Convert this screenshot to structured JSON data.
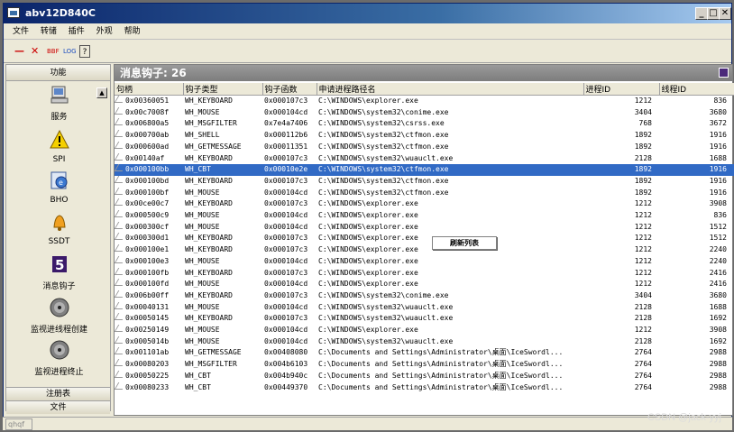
{
  "window": {
    "title": "abv12D840C"
  },
  "menu": [
    "文件",
    "转储",
    "插件",
    "外观",
    "帮助"
  ],
  "toolbar": {
    "minus": "—",
    "close": "✕",
    "bbf": "BBF",
    "log": "LOG",
    "help": "?"
  },
  "sidebar": {
    "header": "功能",
    "items": [
      {
        "label": "服务",
        "icon": "computer-icon"
      },
      {
        "label": "SPI",
        "icon": "warning-icon"
      },
      {
        "label": "BHO",
        "icon": "browser-icon"
      },
      {
        "label": "SSDT",
        "icon": "bell-icon"
      },
      {
        "label": "消息钩子",
        "icon": "hook-icon"
      },
      {
        "label": "监视进线程创建",
        "icon": "monitor-icon"
      },
      {
        "label": "监视进程终止",
        "icon": "monitor-icon"
      }
    ],
    "footer": [
      "注册表",
      "文件"
    ]
  },
  "content": {
    "banner": "消息钩子: 26",
    "columns": [
      "句柄",
      "钩子类型",
      "钩子函数",
      "申请进程路径名",
      "进程ID",
      "线程ID"
    ],
    "rows": [
      [
        "0x00360051",
        "WH_KEYBOARD",
        "0x000107c3",
        "C:\\WINDOWS\\explorer.exe",
        "1212",
        "836"
      ],
      [
        "0x00c7008f",
        "WH_MOUSE",
        "0x000104cd",
        "C:\\WINDOWS\\system32\\conime.exe",
        "3404",
        "3680"
      ],
      [
        "0x006800a5",
        "WH_MSGFILTER",
        "0x7e4a7406",
        "C:\\WINDOWS\\system32\\csrss.exe",
        "768",
        "3672"
      ],
      [
        "0x000700ab",
        "WH_SHELL",
        "0x000112b6",
        "C:\\WINDOWS\\system32\\ctfmon.exe",
        "1892",
        "1916"
      ],
      [
        "0x000600ad",
        "WH_GETMESSAGE",
        "0x00011351",
        "C:\\WINDOWS\\system32\\ctfmon.exe",
        "1892",
        "1916"
      ],
      [
        "0x00140af",
        "WH_KEYBOARD",
        "0x000107c3",
        "C:\\WINDOWS\\system32\\wuauclt.exe",
        "2128",
        "1688"
      ],
      [
        "0x000100bb",
        "WH_CBT",
        "0x00010e2e",
        "C:\\WINDOWS\\system32\\ctfmon.exe",
        "1892",
        "1916"
      ],
      [
        "0x000100bd",
        "WH_KEYBOARD",
        "0x000107c3",
        "C:\\WINDOWS\\system32\\ctfmon.exe",
        "1892",
        "1916"
      ],
      [
        "0x000100bf",
        "WH_MOUSE",
        "0x000104cd",
        "C:\\WINDOWS\\system32\\ctfmon.exe",
        "1892",
        "1916"
      ],
      [
        "0x00ce00c7",
        "WH_KEYBOARD",
        "0x000107c3",
        "C:\\WINDOWS\\explorer.exe",
        "1212",
        "3908"
      ],
      [
        "0x000500c9",
        "WH_MOUSE",
        "0x000104cd",
        "C:\\WINDOWS\\explorer.exe",
        "1212",
        "836"
      ],
      [
        "0x000300cf",
        "WH_MOUSE",
        "0x000104cd",
        "C:\\WINDOWS\\explorer.exe",
        "1212",
        "1512"
      ],
      [
        "0x000300d1",
        "WH_KEYBOARD",
        "0x000107c3",
        "C:\\WINDOWS\\explorer.exe",
        "1212",
        "1512"
      ],
      [
        "0x000100e1",
        "WH_KEYBOARD",
        "0x000107c3",
        "C:\\WINDOWS\\explorer.exe",
        "1212",
        "2240"
      ],
      [
        "0x000100e3",
        "WH_MOUSE",
        "0x000104cd",
        "C:\\WINDOWS\\explorer.exe",
        "1212",
        "2240"
      ],
      [
        "0x000100fb",
        "WH_KEYBOARD",
        "0x000107c3",
        "C:\\WINDOWS\\explorer.exe",
        "1212",
        "2416"
      ],
      [
        "0x000100fd",
        "WH_MOUSE",
        "0x000104cd",
        "C:\\WINDOWS\\explorer.exe",
        "1212",
        "2416"
      ],
      [
        "0x006b00ff",
        "WH_KEYBOARD",
        "0x000107c3",
        "C:\\WINDOWS\\system32\\conime.exe",
        "3404",
        "3680"
      ],
      [
        "0x00040131",
        "WH_MOUSE",
        "0x000104cd",
        "C:\\WINDOWS\\system32\\wuauclt.exe",
        "2128",
        "1688"
      ],
      [
        "0x00050145",
        "WH_KEYBOARD",
        "0x000107c3",
        "C:\\WINDOWS\\system32\\wuauclt.exe",
        "2128",
        "1692"
      ],
      [
        "0x00250149",
        "WH_MOUSE",
        "0x000104cd",
        "C:\\WINDOWS\\explorer.exe",
        "1212",
        "3908"
      ],
      [
        "0x0005014b",
        "WH_MOUSE",
        "0x000104cd",
        "C:\\WINDOWS\\system32\\wuauclt.exe",
        "2128",
        "1692"
      ],
      [
        "0x001101ab",
        "WH_GETMESSAGE",
        "0x00408080",
        "C:\\Documents and Settings\\Administrator\\桌面\\IceSwordl...",
        "2764",
        "2988"
      ],
      [
        "0x00080203",
        "WH_MSGFILTER",
        "0x004b6103",
        "C:\\Documents and Settings\\Administrator\\桌面\\IceSwordl...",
        "2764",
        "2988"
      ],
      [
        "0x00050225",
        "WH_CBT",
        "0x004b940c",
        "C:\\Documents and Settings\\Administrator\\桌面\\IceSwordl...",
        "2764",
        "2988"
      ],
      [
        "0x00080233",
        "WH_CBT",
        "0x00449370",
        "C:\\Documents and Settings\\Administrator\\桌面\\IceSwordl...",
        "2764",
        "2988"
      ]
    ],
    "selected_row": 6
  },
  "context_menu": {
    "item": "刷新列表"
  },
  "status": {
    "text": "qhqf"
  },
  "watermark": "CSDN @jack-yyj"
}
